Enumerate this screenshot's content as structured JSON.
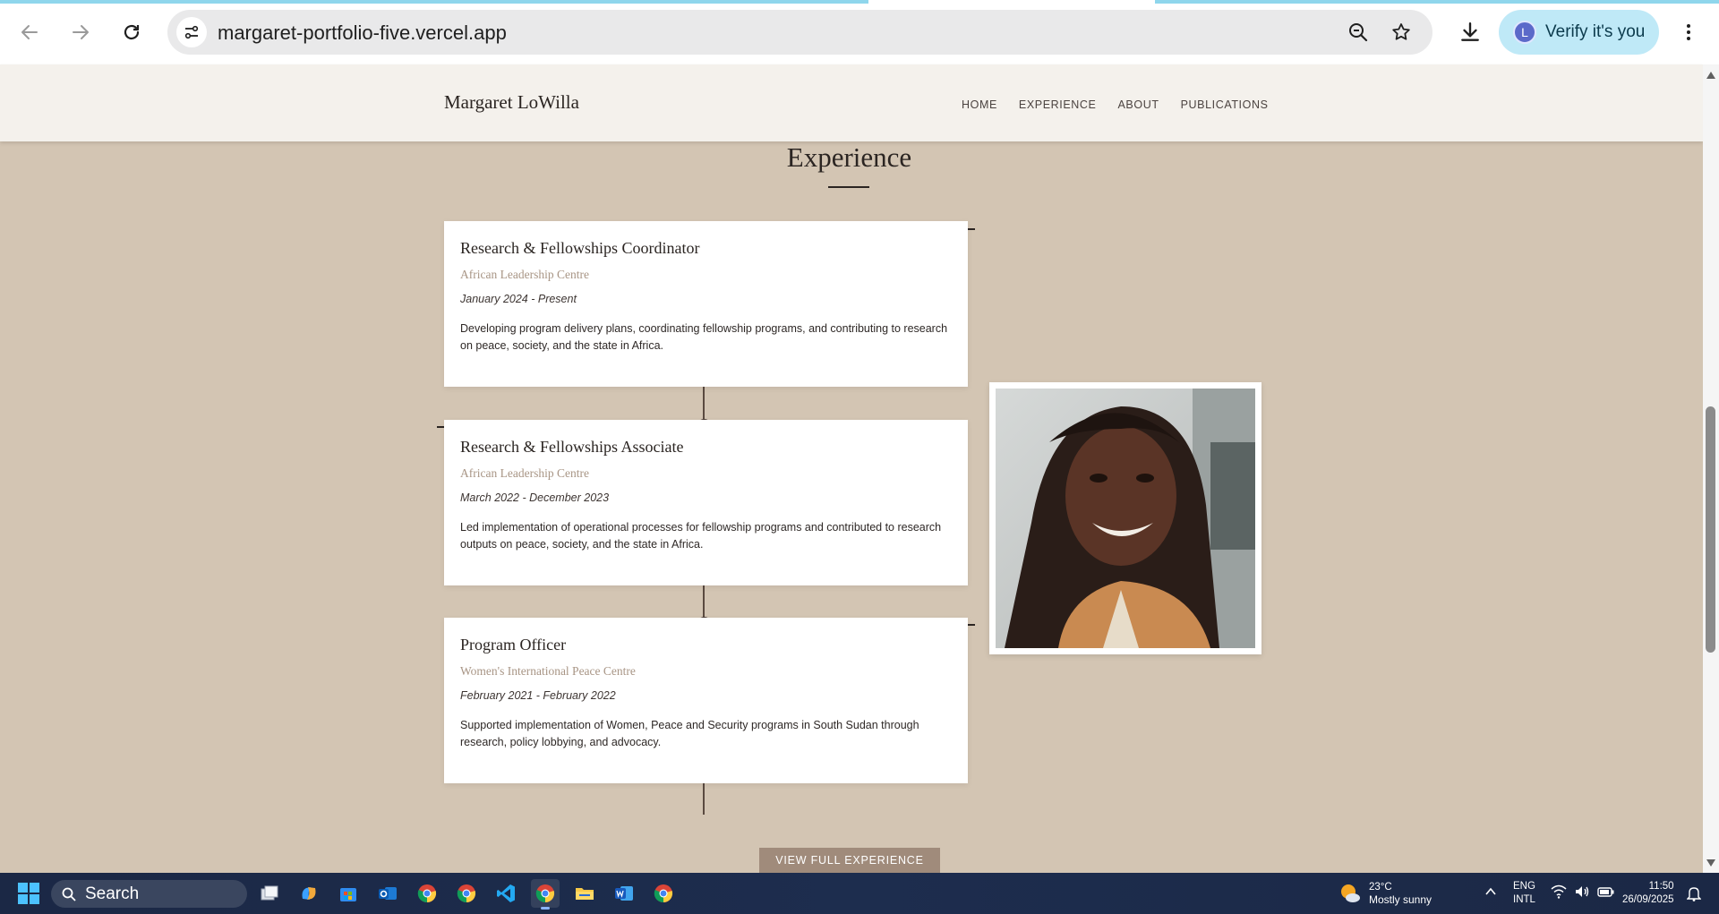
{
  "browser": {
    "url": "margaret-portfolio-five.vercel.app",
    "profile_initial": "L",
    "verify_label": "Verify it's you"
  },
  "site": {
    "brand": "Margaret LoWilla",
    "nav": [
      "HOME",
      "EXPERIENCE",
      "ABOUT",
      "PUBLICATIONS"
    ]
  },
  "experience": {
    "title": "Experience",
    "items": [
      {
        "role": "Research & Fellowships Coordinator",
        "organization": "African Leadership Centre",
        "dates": "January 2024 - Present",
        "description": "Developing program delivery plans, coordinating fellowship programs, and contributing to research on peace, society, and the state in Africa."
      },
      {
        "role": "Research & Fellowships Associate",
        "organization": "African Leadership Centre",
        "dates": "March 2022 - December 2023",
        "description": "Led implementation of operational processes for fellowship programs and contributed to research outputs on peace, society, and the state in Africa."
      },
      {
        "role": "Program Officer",
        "organization": "Women's International Peace Centre",
        "dates": "February 2021 - February 2022",
        "description": "Supported implementation of Women, Peace and Security programs in South Sudan through research, policy lobbying, and advocacy."
      }
    ],
    "cta_label": "VIEW FULL EXPERIENCE"
  },
  "colors": {
    "page_background": "#d3c5b3",
    "header_background": "#f4f1ec",
    "accent": "#a08b7b",
    "organization_text": "#a89585",
    "verify_chip": "#bfe9f7"
  },
  "taskbar": {
    "search_label": "Search",
    "weather_temp": "23°C",
    "weather_condition": "Mostly sunny",
    "language": "ENG",
    "keyboard": "INTL",
    "time": "11:50",
    "date": "26/09/2025",
    "apps": [
      "task-view",
      "copilot",
      "store",
      "outlook",
      "chrome",
      "chrome-profile",
      "vscode",
      "chrome-active",
      "file-explorer",
      "word",
      "chrome-alt"
    ]
  }
}
